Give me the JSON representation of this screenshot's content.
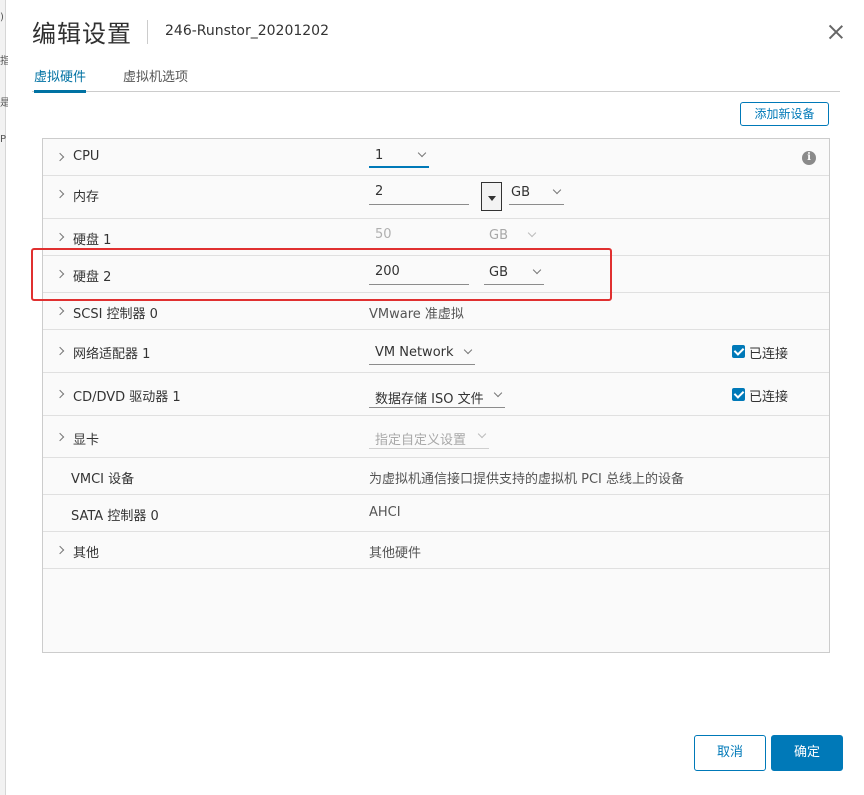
{
  "background": {
    "fragments": [
      ")",
      "指",
      "是",
      "P"
    ]
  },
  "dialog": {
    "title": "编辑设置",
    "vm_name": "246-Runstor_20201202"
  },
  "tabs": [
    {
      "label": "虚拟硬件",
      "active": true
    },
    {
      "label": "虚拟机选项",
      "active": false
    }
  ],
  "add_device_label": "添加新设备",
  "hardware": {
    "cpu": {
      "label": "CPU",
      "value": "1"
    },
    "memory": {
      "label": "内存",
      "value": "2",
      "unit": "GB"
    },
    "disk1": {
      "label": "硬盘 1",
      "value": "50",
      "unit": "GB"
    },
    "disk2": {
      "label": "硬盘 2",
      "value": "200",
      "unit": "GB"
    },
    "scsi": {
      "label": "SCSI 控制器 0",
      "value": "VMware 准虚拟"
    },
    "network": {
      "label": "网络适配器 1",
      "value": "VM Network",
      "connected_label": "已连接",
      "connected": true
    },
    "cddvd": {
      "label": "CD/DVD 驱动器 1",
      "value": "数据存储 ISO 文件",
      "connected_label": "已连接",
      "connected": true
    },
    "video": {
      "label": "显卡",
      "value": "指定自定义设置"
    },
    "vmci": {
      "label": "VMCI 设备",
      "value": "为虚拟机通信接口提供支持的虚拟机 PCI 总线上的设备"
    },
    "sata": {
      "label": "SATA 控制器 0",
      "value": "AHCI"
    },
    "other": {
      "label": "其他",
      "value": "其他硬件"
    }
  },
  "buttons": {
    "cancel": "取消",
    "ok": "确定"
  },
  "colors": {
    "accent": "#0079b8",
    "highlight": "#e03030"
  }
}
